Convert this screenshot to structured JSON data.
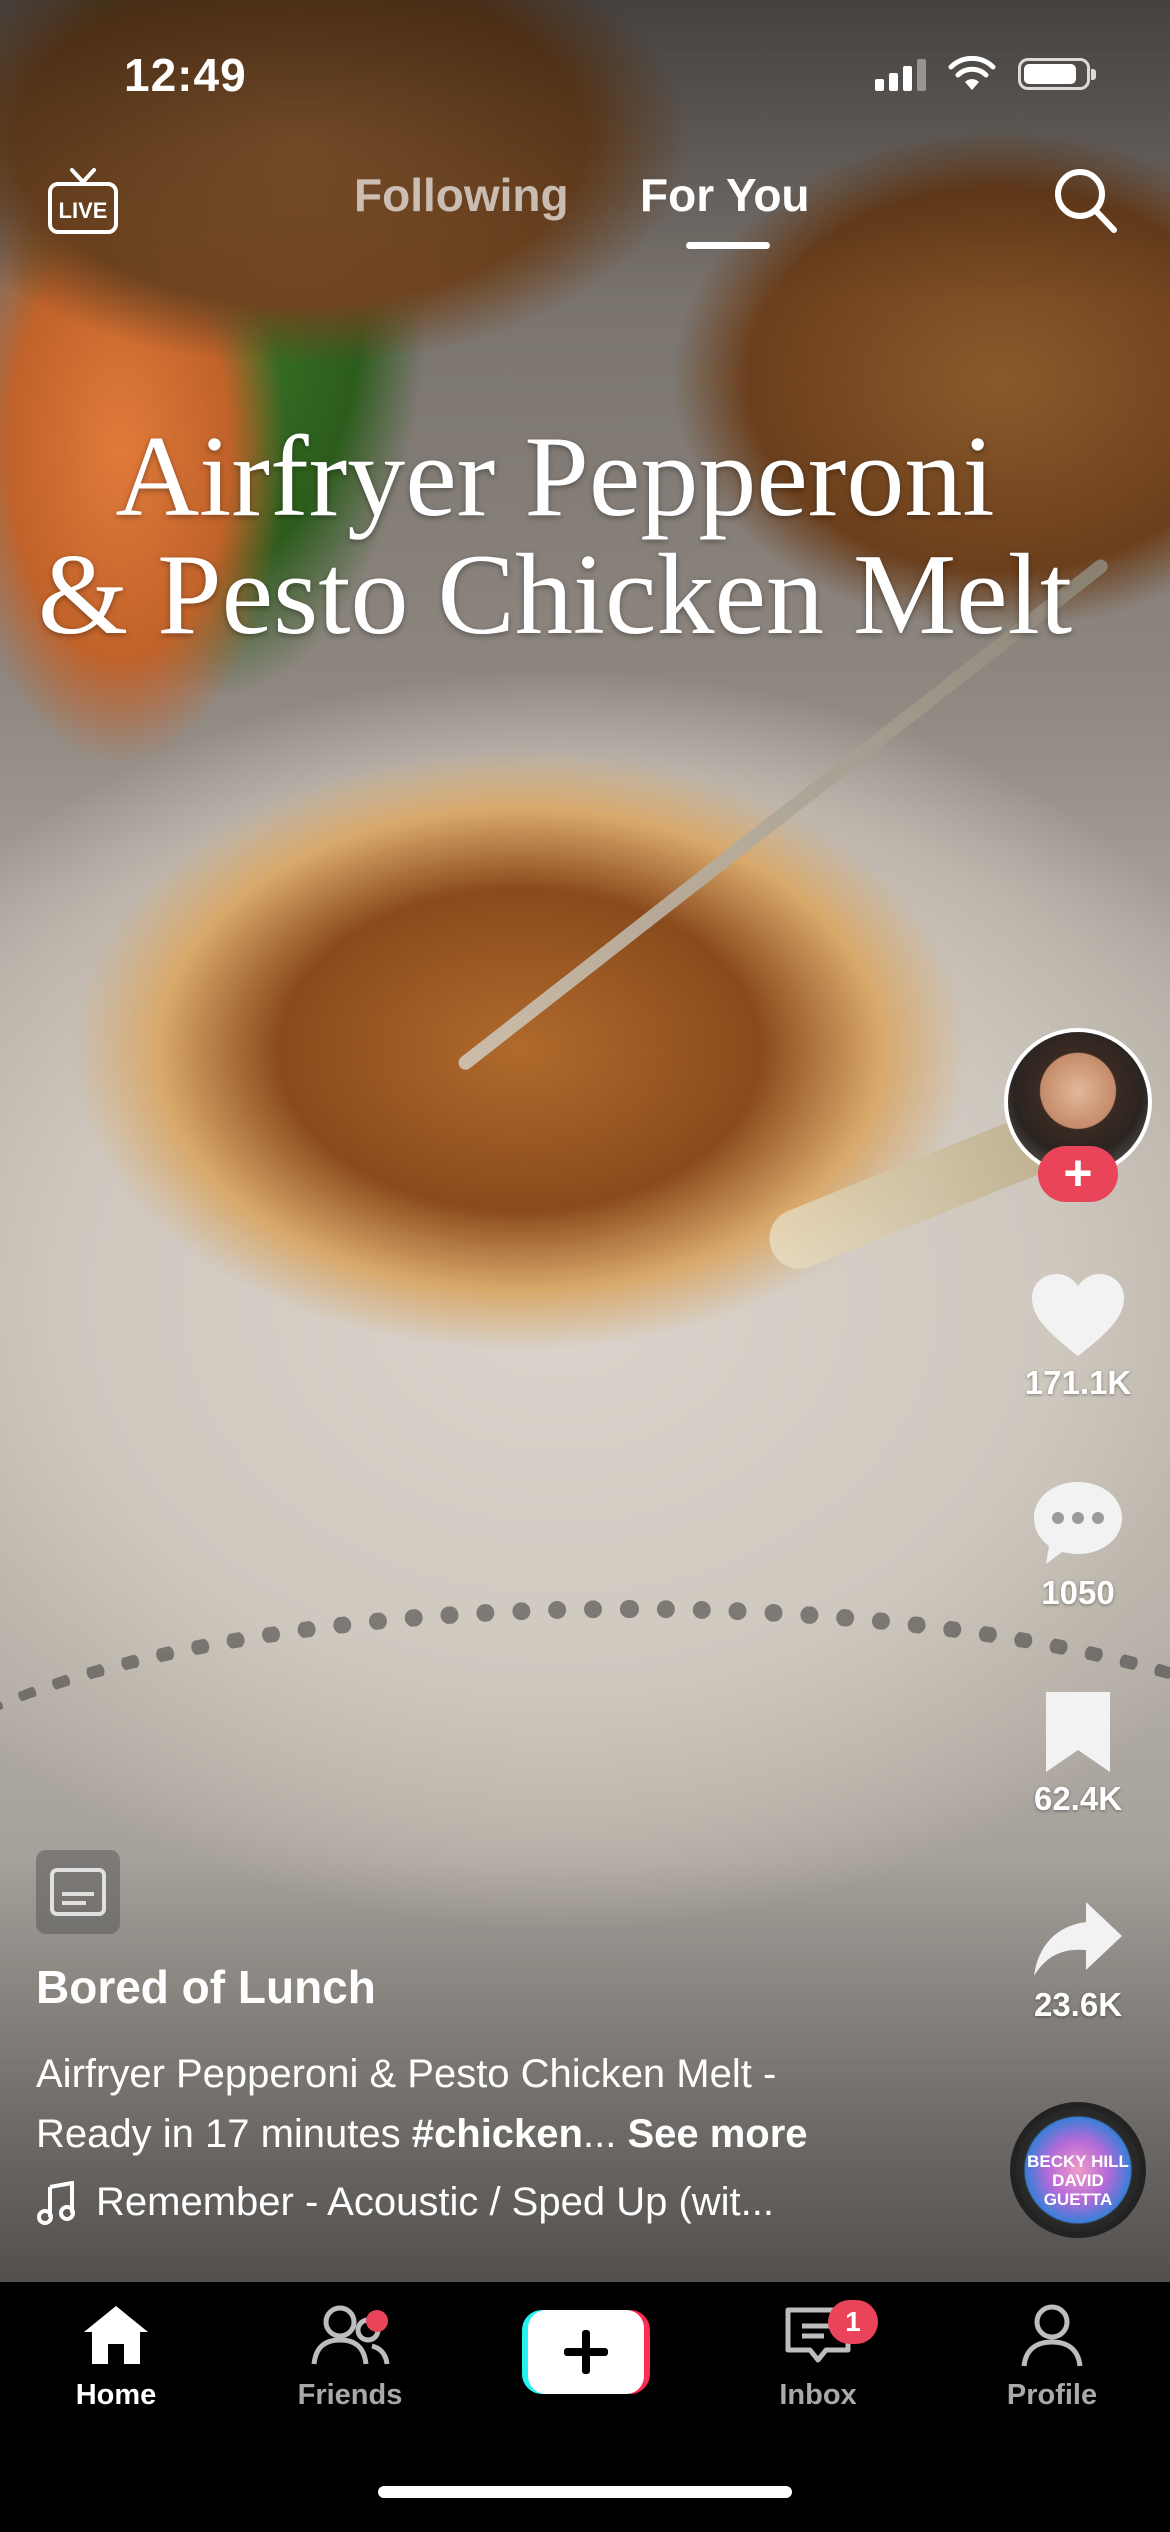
{
  "status_bar": {
    "time": "12:49"
  },
  "top_nav": {
    "live_label": "LIVE",
    "tabs": [
      {
        "label": "Following"
      },
      {
        "label": "For You"
      }
    ]
  },
  "video": {
    "overlay_title_line1": "Airfryer Pepperoni",
    "overlay_title_line2": "& Pesto Chicken Melt",
    "author": "Bored of Lunch",
    "description_line1": "Airfryer Pepperoni & Pesto Chicken Melt -",
    "description_line2_prefix": "Ready in 17 minutes ",
    "description_hashtag": "#chicken",
    "description_ellipsis": "...",
    "see_more": "See more",
    "sound": "Remember - Acoustic / Sped Up (wit..."
  },
  "rail": {
    "likes": "171.1K",
    "comments": "1050",
    "saves": "62.4K",
    "shares": "23.6K",
    "disc_text_line1": "BECKY HILL",
    "disc_text_line2": "DAVID GUETTA"
  },
  "bottom_nav": {
    "items": [
      {
        "label": "Home"
      },
      {
        "label": "Friends"
      },
      {
        "label": "Inbox",
        "badge": "1"
      },
      {
        "label": "Profile"
      }
    ]
  },
  "colors": {
    "accent": "#ea445a",
    "create_cyan": "#25f4ee",
    "create_pink": "#fe2c55"
  }
}
